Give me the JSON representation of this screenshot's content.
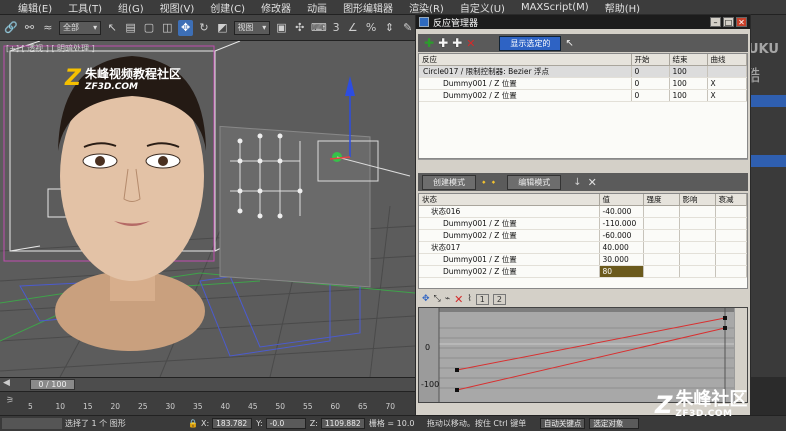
{
  "menu": [
    {
      "label": "编辑(E)"
    },
    {
      "label": "工具(T)"
    },
    {
      "label": "组(G)"
    },
    {
      "label": "视图(V)"
    },
    {
      "label": "创建(C)"
    },
    {
      "label": "修改器"
    },
    {
      "label": "动画"
    },
    {
      "label": "图形编辑器"
    },
    {
      "label": "渲染(R)"
    },
    {
      "label": "自定义(U)"
    },
    {
      "label": "MAXScript(M)"
    },
    {
      "label": "帮助(H)"
    }
  ],
  "toolbar": {
    "filter_value": "全部",
    "view_value": "视图",
    "snap_value": "3"
  },
  "viewport": {
    "label": "[+] [ 透视 ] [ 明暗处理 ]",
    "watermark_cn": "朱峰视频教程社区",
    "watermark_en": "ZF3D.COM"
  },
  "youku": {
    "line1": "YOUKU",
    "line2": "优酷"
  },
  "reaction_window": {
    "title": "反应管理器",
    "show_selected_button": "显示选定的",
    "columns": [
      "反应",
      "开始",
      "结束",
      "曲线"
    ],
    "reactions": [
      {
        "name": "Circle017 / 限制控制器: Bezier 浮点",
        "start": "0",
        "end": "100",
        "curve": "",
        "highlight": true
      },
      {
        "name": "Dummy001 / Z 位置",
        "start": "0",
        "end": "100",
        "curve": "X",
        "highlight": false
      },
      {
        "name": "Dummy002 / Z 位置",
        "start": "0",
        "end": "100",
        "curve": "X",
        "highlight": false
      }
    ],
    "create_mode_label": "创建模式",
    "edit_mode_label": "编辑模式",
    "state_columns": [
      "状态",
      "值",
      "强度",
      "影响",
      "衰减"
    ],
    "states": [
      {
        "name": "状态016",
        "value": "-40.000",
        "indent": 1,
        "selected": false
      },
      {
        "name": "Dummy001 / Z 位置",
        "value": "-110.000",
        "indent": 2,
        "selected": false
      },
      {
        "name": "Dummy002 / Z 位置",
        "value": "-60.000",
        "indent": 2,
        "selected": false
      },
      {
        "name": "状态017",
        "value": "40.000",
        "indent": 1,
        "selected": false
      },
      {
        "name": "Dummy001 / Z 位置",
        "value": "30.000",
        "indent": 2,
        "selected": false
      },
      {
        "name": "Dummy002 / Z 位置",
        "value": "80",
        "indent": 2,
        "selected": true
      }
    ],
    "curve_tabs": [
      "1",
      "2"
    ],
    "curve_y_labels": [
      "0",
      "-100"
    ]
  },
  "timeline": {
    "frame_display": "0 / 100",
    "ticks": [
      "5",
      "10",
      "15",
      "20",
      "25",
      "30",
      "35",
      "40",
      "45",
      "50",
      "55",
      "60",
      "65",
      "70"
    ]
  },
  "status": {
    "selection_text": "选择了 1 个 图形",
    "x_label": "X:",
    "x_value": "183.782",
    "y_label": "Y:",
    "y_value": "-0.0",
    "z_label": "Z:",
    "z_value": "1109.882",
    "grid_label": "栅格 = 10.0",
    "hint_text": "拖动以移动。按住 Ctrl 键单",
    "auto_key": "自动关键点",
    "selection_set": "选定对象"
  },
  "logo": {
    "cn": "朱峰社区",
    "en": "ZF3D.COM"
  },
  "colors": {
    "highlight_blue": "#2e63c4",
    "selected_value": "#6b5a1c",
    "curve_red": "#d83030"
  }
}
